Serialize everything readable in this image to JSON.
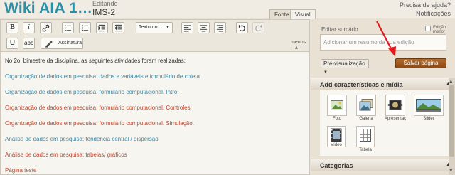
{
  "header": {
    "wiki_title": "Wiki AIA 1…",
    "editing_label": "Editando",
    "page_name": "IMS-2",
    "help_link": "Precisa de ajuda?",
    "notifications_link": "Notificações"
  },
  "tabs": {
    "source": "Fonte",
    "visual": "Visual"
  },
  "toolbar": {
    "bold": "B",
    "italic": "i",
    "underline": "U",
    "strike": "abc",
    "text_style_select": "Texto no…",
    "signature_label": "Assinatura",
    "less_label": "menos"
  },
  "content": {
    "lines": [
      "No 2o. bimestre da disciplina, as seguintes atividades foram realizadas:",
      "Organização de dados em pesquisa: dados e variáveis e formulário de coleta",
      "Organização de dados em pesquisa: formulário computacional. Intro.",
      "Organização de dados em pesquisa: formulário computacional. Controles.",
      "Organização de dados em pesquisa: formulário computacional. Simulação.",
      "Análise de dados em pesquisa: tendência central / dispersão",
      "Análise de dados em pesquisa: tabelas/ gráficos",
      "Página teste"
    ]
  },
  "sidebar": {
    "summary_label": "Editar sumário",
    "minor_edit_label": "Edição menor",
    "summary_placeholder": "Adicionar um resumo da sua edição",
    "preview_label": "Pré-visualização",
    "save_label": "Salvar página",
    "media_section_title": "Add características e mídia",
    "media_items": {
      "photo": "Foto",
      "gallery": "Galeria",
      "slideshow": "Apresentaç",
      "slider": "Slider",
      "video": "Vídeo",
      "table": "Tabela"
    },
    "categories_title": "Categorias"
  },
  "colors": {
    "title_teal": "#2a90a8",
    "link_blue": "#3f88a5",
    "link_red": "#c0472e",
    "save_brown": "#9c561e",
    "annotation_arrow": "#e0191d"
  }
}
